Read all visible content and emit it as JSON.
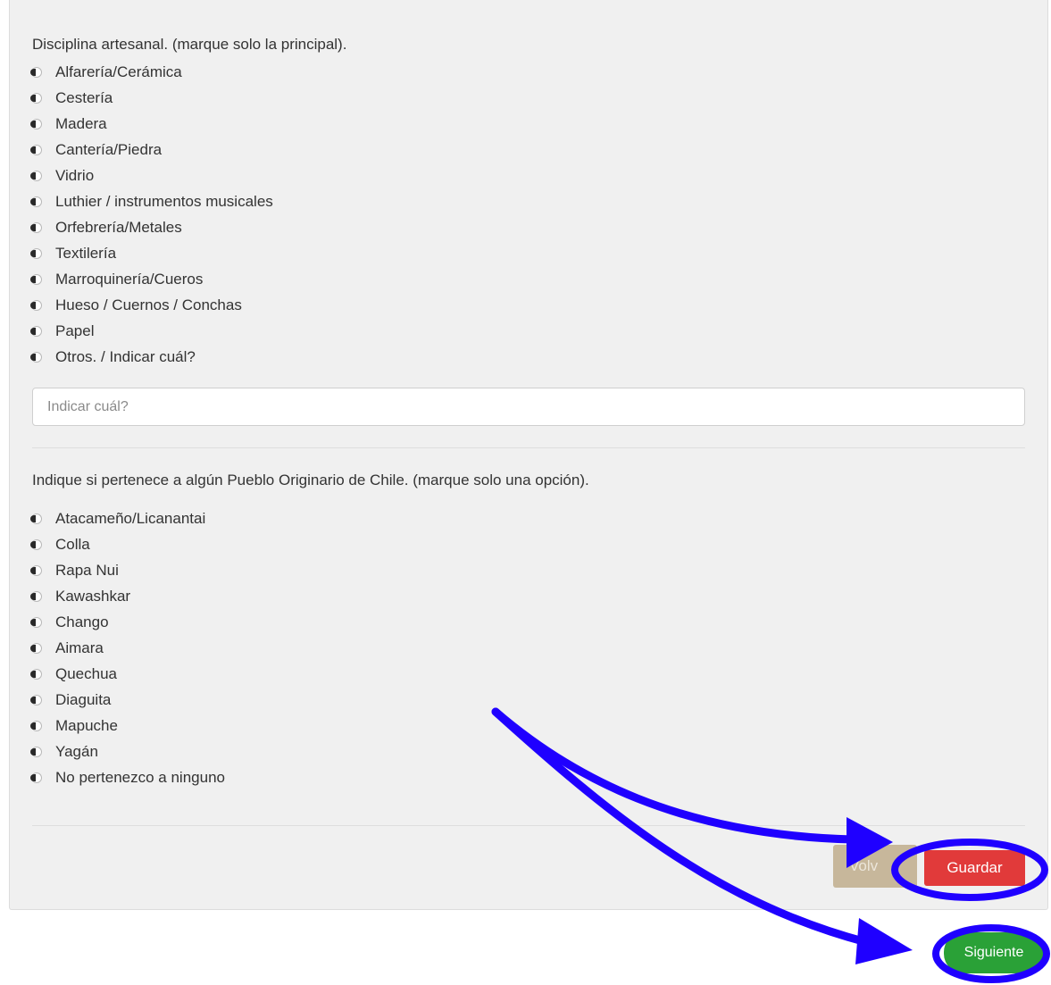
{
  "form": {
    "q1": {
      "label": "Disciplina artesanal. (marque solo la principal).",
      "options": [
        "Alfarería/Cerámica",
        "Cestería",
        "Madera",
        "Cantería/Piedra",
        "Vidrio",
        "Luthier / instrumentos musicales",
        "Orfebrería/Metales",
        "Textilería",
        "Marroquinería/Cueros",
        "Hueso / Cuernos / Conchas",
        "Papel",
        "Otros. / Indicar cuál?"
      ],
      "other_input": {
        "placeholder": "Indicar cuál?",
        "value": ""
      }
    },
    "q2": {
      "label": "Indique si pertenece a algún Pueblo Originario de Chile. (marque solo una opción).",
      "options": [
        "Atacameño/Licanantai",
        "Colla",
        "Rapa Nui",
        "Kawashkar",
        "Chango",
        "Aimara",
        "Quechua",
        "Diaguita",
        "Mapuche",
        "Yagán",
        "No pertenezco a ninguno"
      ]
    }
  },
  "buttons": {
    "volver": "Volv",
    "guardar": "Guardar",
    "siguiente": "Siguiente"
  },
  "colors": {
    "panel_bg": "#f0f0f0",
    "guardar": "#e13a3a",
    "volver": "#c7b79b",
    "siguiente": "#2aa137",
    "annotation": "#1f00ff"
  }
}
